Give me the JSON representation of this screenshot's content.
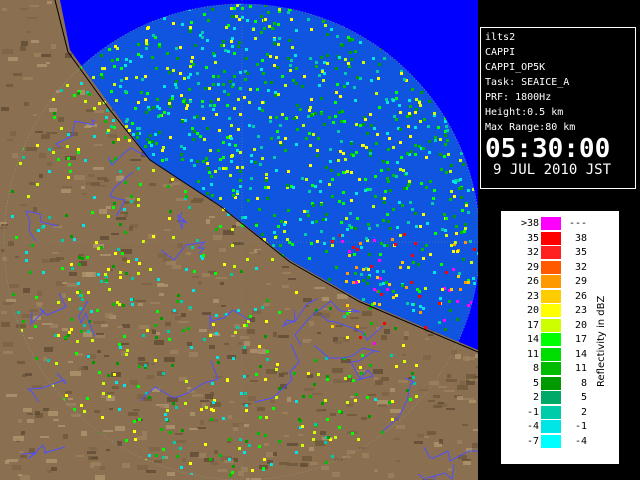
{
  "info": {
    "radar": "ilts2",
    "product": "CAPPI",
    "product_code": "CAPPI_OP5K",
    "task": "Task: SEAICE_A",
    "prf": "PRF: 1800Hz",
    "height": "Height:0.5 km",
    "max_range": "Max Range:80 km",
    "time": "05:30:00",
    "date": "9 JUL 2010 JST"
  },
  "legend": {
    "unit": "Reflectivity in dBZ",
    "rows": [
      {
        "low": ">38",
        "high": "---",
        "color": "#ff00ff"
      },
      {
        "low": "35",
        "high": "38",
        "color": "#ff0000"
      },
      {
        "low": "32",
        "high": "35",
        "color": "#ff2020"
      },
      {
        "low": "29",
        "high": "32",
        "color": "#ff5a00"
      },
      {
        "low": "26",
        "high": "29",
        "color": "#ff9900"
      },
      {
        "low": "23",
        "high": "26",
        "color": "#ffcc00"
      },
      {
        "low": "20",
        "high": "23",
        "color": "#ffff00"
      },
      {
        "low": "17",
        "high": "20",
        "color": "#ccff00"
      },
      {
        "low": "14",
        "high": "17",
        "color": "#00ff00"
      },
      {
        "low": "11",
        "high": "14",
        "color": "#00dd00"
      },
      {
        "low": "8",
        "high": "11",
        "color": "#00bb00"
      },
      {
        "low": "5",
        "high": "8",
        "color": "#009900"
      },
      {
        "low": "2",
        "high": "5",
        "color": "#00aa66"
      },
      {
        "low": "-1",
        "high": "2",
        "color": "#00ccaa"
      },
      {
        "low": "-4",
        "high": "-1",
        "color": "#00e5e5"
      },
      {
        "low": "-7",
        "high": "-4",
        "color": "#00ffff"
      }
    ]
  },
  "colors": {
    "sea_echo_background": "#1055e0",
    "outside_radar": "#0000ff",
    "terrain": "#8a7050",
    "coastline": "#000000",
    "rivers": "#5050ff"
  }
}
